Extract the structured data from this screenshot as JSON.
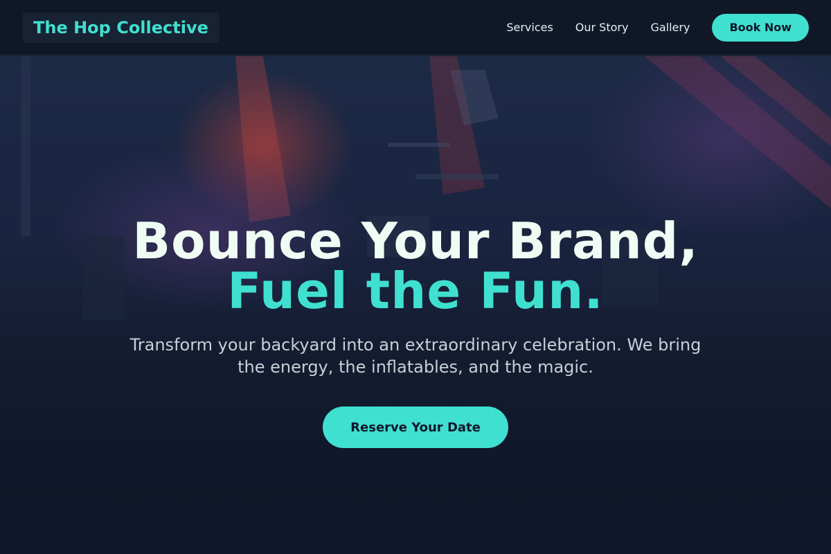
{
  "header": {
    "logo_text": "The Hop Collective",
    "nav": [
      {
        "label": "Services"
      },
      {
        "label": "Our Story"
      },
      {
        "label": "Gallery"
      }
    ],
    "book_label": "Book Now"
  },
  "hero": {
    "headline_line1": "Bounce Your Brand,",
    "headline_line2": "Fuel the Fun.",
    "subtext": "Transform your backyard into an extraordinary celebration. We bring the energy, the inflatables, and the magic.",
    "cta_label": "Reserve Your Date"
  },
  "colors": {
    "accent": "#40e0d0",
    "background": "#0f172a",
    "headline": "#f0fdf4"
  }
}
